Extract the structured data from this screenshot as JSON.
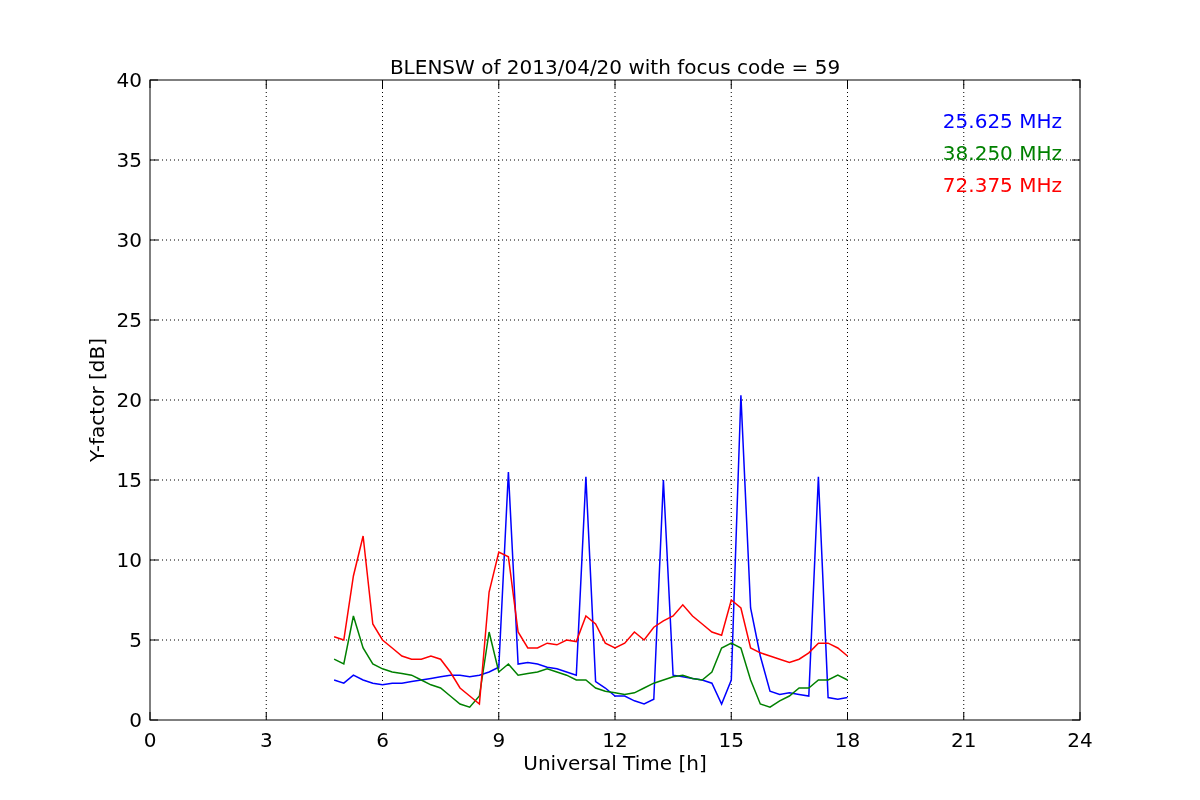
{
  "chart_data": {
    "type": "line",
    "title": "BLENSW of 2013/04/20 with focus code = 59",
    "xlabel": "Universal Time [h]",
    "ylabel": "Y-factor [dB]",
    "xlim": [
      0,
      24
    ],
    "ylim": [
      0,
      40
    ],
    "xticks": [
      0,
      3,
      6,
      9,
      12,
      15,
      18,
      21,
      24
    ],
    "yticks": [
      0,
      5,
      10,
      15,
      20,
      25,
      30,
      35,
      40
    ],
    "grid": true,
    "x": [
      4.75,
      5,
      5.25,
      5.5,
      5.75,
      6,
      6.25,
      6.5,
      6.75,
      7,
      7.25,
      7.5,
      7.75,
      8,
      8.25,
      8.5,
      8.75,
      9,
      9.25,
      9.5,
      9.75,
      10,
      10.25,
      10.5,
      10.75,
      11,
      11.25,
      11.5,
      11.75,
      12,
      12.25,
      12.5,
      12.75,
      13,
      13.25,
      13.5,
      13.75,
      14,
      14.25,
      14.5,
      14.75,
      15,
      15.25,
      15.5,
      15.75,
      16,
      16.25,
      16.5,
      16.75,
      17,
      17.25,
      17.5,
      17.75,
      18
    ],
    "series": [
      {
        "name": "25.625 MHz",
        "color": "#0000ff",
        "values": [
          2.5,
          2.3,
          2.8,
          2.5,
          2.3,
          2.2,
          2.3,
          2.3,
          2.4,
          2.5,
          2.6,
          2.7,
          2.8,
          2.8,
          2.7,
          2.8,
          3.0,
          3.3,
          15.5,
          3.5,
          3.6,
          3.5,
          3.3,
          3.2,
          3.0,
          2.8,
          15.2,
          2.4,
          2.0,
          1.5,
          1.5,
          1.2,
          1.0,
          1.3,
          15.0,
          2.8,
          2.7,
          2.6,
          2.5,
          2.3,
          1.0,
          2.5,
          20.3,
          7.0,
          4.0,
          1.8,
          1.6,
          1.7,
          1.6,
          1.5,
          15.2,
          1.4,
          1.3,
          1.4
        ]
      },
      {
        "name": "38.250 MHz",
        "color": "#008000",
        "values": [
          3.8,
          3.5,
          6.5,
          4.5,
          3.5,
          3.2,
          3.0,
          2.9,
          2.8,
          2.5,
          2.2,
          2.0,
          1.5,
          1.0,
          0.8,
          1.5,
          5.5,
          3.0,
          3.5,
          2.8,
          2.9,
          3.0,
          3.2,
          3.0,
          2.8,
          2.5,
          2.5,
          2.0,
          1.8,
          1.7,
          1.6,
          1.7,
          2.0,
          2.3,
          2.5,
          2.7,
          2.8,
          2.6,
          2.5,
          3.0,
          4.5,
          4.8,
          4.5,
          2.5,
          1.0,
          0.8,
          1.2,
          1.5,
          2.0,
          2.0,
          2.5,
          2.5,
          2.8,
          2.5
        ]
      },
      {
        "name": "72.375 MHz",
        "color": "#ff0000",
        "values": [
          5.2,
          5.0,
          9.0,
          11.5,
          6.0,
          5.0,
          4.5,
          4.0,
          3.8,
          3.8,
          4.0,
          3.8,
          3.0,
          2.0,
          1.5,
          1.0,
          8.0,
          10.5,
          10.2,
          5.5,
          4.5,
          4.5,
          4.8,
          4.7,
          5.0,
          4.9,
          6.5,
          6.0,
          4.8,
          4.5,
          4.8,
          5.5,
          5.0,
          5.8,
          6.2,
          6.5,
          7.2,
          6.5,
          6.0,
          5.5,
          5.3,
          7.5,
          7.0,
          4.5,
          4.2,
          4.0,
          3.8,
          3.6,
          3.8,
          4.2,
          4.8,
          4.8,
          4.5,
          4.0
        ]
      }
    ]
  }
}
